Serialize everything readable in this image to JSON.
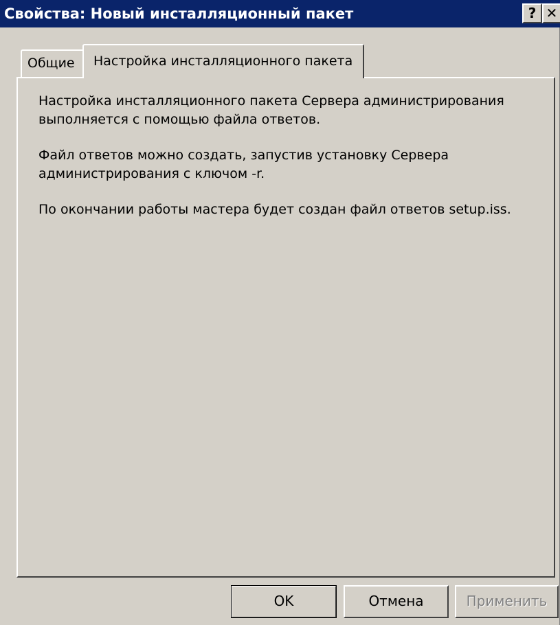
{
  "window": {
    "title": "Свойства: Новый инсталляционный пакет",
    "help_label": "?",
    "close_label": "✕"
  },
  "tabs": [
    {
      "label": "Общие",
      "active": false
    },
    {
      "label": "Настройка инсталляционного пакета",
      "active": true
    }
  ],
  "panel": {
    "paragraphs": [
      "Настройка инсталляционного пакета Сервера администрирования выполняется с помощью файла ответов.",
      "Файл ответов можно создать, запустив установку Сервера администрирования с ключом -r.",
      "По окончании работы мастера будет создан файл ответов setup.iss."
    ]
  },
  "buttons": {
    "ok": "OK",
    "cancel": "Отмена",
    "apply": "Применить"
  },
  "colors": {
    "titlebar": "#0a246a",
    "face": "#d4d0c8",
    "disabled_text": "#808080"
  }
}
